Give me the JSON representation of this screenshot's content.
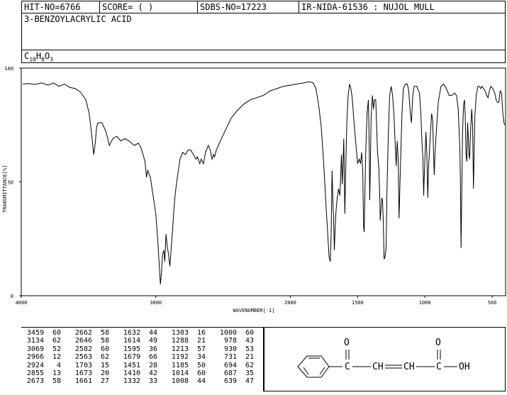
{
  "header": {
    "hit_no": "HIT-NO=6766",
    "score": "SCORE=  (   )",
    "sdbs_no": "SDBS-NO=17223",
    "ir_nida": "IR-NIDA-61536 : NUJOL MULL",
    "compound_name": "3-BENZOYLACRYLIC ACID",
    "formula_C": "C",
    "formula_C_sub": "10",
    "formula_H": "H",
    "formula_H_sub": "8",
    "formula_O": "O",
    "formula_O_sub": "3"
  },
  "chart_data": {
    "type": "line",
    "xlabel": "WAVENUMBER[-1]",
    "ylabel": "TRANSMITTANCE[%]",
    "xlim": [
      4000,
      400
    ],
    "ylim": [
      0,
      100
    ],
    "x_ticks": [
      4000,
      3000,
      2000,
      1500,
      1000,
      500
    ],
    "y_ticks": [
      0,
      50,
      100
    ],
    "series": [
      {
        "color": "#000000",
        "points": [
          [
            3988,
            93
          ],
          [
            3950,
            93.2
          ],
          [
            3900,
            92.8
          ],
          [
            3850,
            93.5
          ],
          [
            3800,
            92.5
          ],
          [
            3760,
            93.5
          ],
          [
            3720,
            92
          ],
          [
            3680,
            93
          ],
          [
            3640,
            91.5
          ],
          [
            3600,
            91
          ],
          [
            3560,
            89.5
          ],
          [
            3520,
            86
          ],
          [
            3495,
            80
          ],
          [
            3475,
            70
          ],
          [
            3462,
            62
          ],
          [
            3450,
            67
          ],
          [
            3440,
            74
          ],
          [
            3430,
            76
          ],
          [
            3400,
            76
          ],
          [
            3370,
            72
          ],
          [
            3345,
            66
          ],
          [
            3320,
            69
          ],
          [
            3290,
            70
          ],
          [
            3260,
            68
          ],
          [
            3230,
            69
          ],
          [
            3200,
            68
          ],
          [
            3180,
            67
          ],
          [
            3160,
            66
          ],
          [
            3130,
            67
          ],
          [
            3110,
            65
          ],
          [
            3095,
            62
          ],
          [
            3080,
            59
          ],
          [
            3069,
            52
          ],
          [
            3060,
            55
          ],
          [
            3040,
            52
          ],
          [
            3020,
            44
          ],
          [
            3000,
            36
          ],
          [
            2985,
            24
          ],
          [
            2975,
            14
          ],
          [
            2966,
            5
          ],
          [
            2958,
            10
          ],
          [
            2950,
            18
          ],
          [
            2940,
            20
          ],
          [
            2933,
            15
          ],
          [
            2924,
            27
          ],
          [
            2915,
            22
          ],
          [
            2905,
            18
          ],
          [
            2895,
            13
          ],
          [
            2887,
            20
          ],
          [
            2876,
            28
          ],
          [
            2865,
            38
          ],
          [
            2855,
            45
          ],
          [
            2840,
            52
          ],
          [
            2820,
            60
          ],
          [
            2800,
            63
          ],
          [
            2780,
            62
          ],
          [
            2760,
            64
          ],
          [
            2740,
            64
          ],
          [
            2720,
            62
          ],
          [
            2700,
            60
          ],
          [
            2690,
            61
          ],
          [
            2673,
            58
          ],
          [
            2662,
            60
          ],
          [
            2646,
            58
          ],
          [
            2630,
            63
          ],
          [
            2610,
            66
          ],
          [
            2595,
            64
          ],
          [
            2582,
            60
          ],
          [
            2570,
            62
          ],
          [
            2563,
            61
          ],
          [
            2550,
            64
          ],
          [
            2520,
            68
          ],
          [
            2480,
            73
          ],
          [
            2440,
            78
          ],
          [
            2400,
            81
          ],
          [
            2350,
            84
          ],
          [
            2300,
            86
          ],
          [
            2250,
            87
          ],
          [
            2200,
            88
          ],
          [
            2150,
            90
          ],
          [
            2100,
            91
          ],
          [
            2050,
            92
          ],
          [
            2000,
            92.5
          ],
          [
            1950,
            93
          ],
          [
            1900,
            93.5
          ],
          [
            1860,
            94
          ],
          [
            1830,
            93.5
          ],
          [
            1810,
            91
          ],
          [
            1790,
            84
          ],
          [
            1770,
            74
          ],
          [
            1750,
            56
          ],
          [
            1735,
            40
          ],
          [
            1720,
            25
          ],
          [
            1712,
            17
          ],
          [
            1703,
            15
          ],
          [
            1697,
            26
          ],
          [
            1690,
            55
          ],
          [
            1682,
            38
          ],
          [
            1679,
            36
          ],
          [
            1676,
            28
          ],
          [
            1673,
            20
          ],
          [
            1668,
            28
          ],
          [
            1661,
            37
          ],
          [
            1652,
            43
          ],
          [
            1642,
            47
          ],
          [
            1632,
            44
          ],
          [
            1625,
            54
          ],
          [
            1620,
            62
          ],
          [
            1614,
            49
          ],
          [
            1608,
            58
          ],
          [
            1603,
            69
          ],
          [
            1595,
            36
          ],
          [
            1588,
            56
          ],
          [
            1580,
            76
          ],
          [
            1570,
            88
          ],
          [
            1560,
            93
          ],
          [
            1550,
            91
          ],
          [
            1540,
            87
          ],
          [
            1530,
            79
          ],
          [
            1515,
            68
          ],
          [
            1500,
            58
          ],
          [
            1488,
            60
          ],
          [
            1478,
            58
          ],
          [
            1470,
            63
          ],
          [
            1462,
            55
          ],
          [
            1458,
            40
          ],
          [
            1455,
            30
          ],
          [
            1451,
            28
          ],
          [
            1446,
            45
          ],
          [
            1440,
            62
          ],
          [
            1430,
            80
          ],
          [
            1420,
            86
          ],
          [
            1413,
            64
          ],
          [
            1410,
            42
          ],
          [
            1405,
            56
          ],
          [
            1400,
            78
          ],
          [
            1390,
            88
          ],
          [
            1382,
            82
          ],
          [
            1375,
            86
          ],
          [
            1365,
            86
          ],
          [
            1352,
            63
          ],
          [
            1342,
            56
          ],
          [
            1335,
            43
          ],
          [
            1332,
            33
          ],
          [
            1328,
            36
          ],
          [
            1320,
            43
          ],
          [
            1315,
            42
          ],
          [
            1310,
            34
          ],
          [
            1303,
            16
          ],
          [
            1296,
            17
          ],
          [
            1288,
            21
          ],
          [
            1282,
            46
          ],
          [
            1272,
            70
          ],
          [
            1262,
            88
          ],
          [
            1250,
            92
          ],
          [
            1240,
            88
          ],
          [
            1230,
            80
          ],
          [
            1218,
            63
          ],
          [
            1213,
            57
          ],
          [
            1206,
            68
          ],
          [
            1198,
            60
          ],
          [
            1192,
            34
          ],
          [
            1188,
            42
          ],
          [
            1185,
            50
          ],
          [
            1178,
            64
          ],
          [
            1170,
            80
          ],
          [
            1160,
            91
          ],
          [
            1145,
            93
          ],
          [
            1130,
            93
          ],
          [
            1120,
            90
          ],
          [
            1108,
            80
          ],
          [
            1100,
            76
          ],
          [
            1090,
            88
          ],
          [
            1080,
            92
          ],
          [
            1060,
            92
          ],
          [
            1040,
            89
          ],
          [
            1030,
            80
          ],
          [
            1022,
            68
          ],
          [
            1014,
            60
          ],
          [
            1009,
            44
          ],
          [
            1006,
            50
          ],
          [
            1000,
            60
          ],
          [
            992,
            72
          ],
          [
            985,
            62
          ],
          [
            978,
            43
          ],
          [
            973,
            56
          ],
          [
            960,
            70
          ],
          [
            950,
            80
          ],
          [
            942,
            77
          ],
          [
            935,
            62
          ],
          [
            930,
            53
          ],
          [
            925,
            62
          ],
          [
            915,
            72
          ],
          [
            900,
            85
          ],
          [
            880,
            92
          ],
          [
            860,
            93
          ],
          [
            840,
            91
          ],
          [
            820,
            88
          ],
          [
            800,
            88
          ],
          [
            780,
            89
          ],
          [
            765,
            88
          ],
          [
            752,
            82
          ],
          [
            740,
            65
          ],
          [
            736,
            50
          ],
          [
            731,
            21
          ],
          [
            726,
            44
          ],
          [
            720,
            72
          ],
          [
            712,
            84
          ],
          [
            705,
            86
          ],
          [
            700,
            79
          ],
          [
            694,
            62
          ],
          [
            688,
            59
          ],
          [
            682,
            76
          ],
          [
            676,
            68
          ],
          [
            672,
            62
          ],
          [
            667,
            60
          ],
          [
            662,
            70
          ],
          [
            652,
            82
          ],
          [
            645,
            75
          ],
          [
            639,
            47
          ],
          [
            634,
            62
          ],
          [
            628,
            79
          ],
          [
            618,
            88
          ],
          [
            606,
            92
          ],
          [
            595,
            92
          ],
          [
            585,
            91
          ],
          [
            575,
            92
          ],
          [
            565,
            91
          ],
          [
            552,
            90
          ],
          [
            540,
            88
          ],
          [
            530,
            87
          ],
          [
            520,
            90
          ],
          [
            510,
            92
          ],
          [
            495,
            91
          ],
          [
            480,
            89
          ],
          [
            470,
            86
          ],
          [
            460,
            85
          ],
          [
            450,
            85
          ],
          [
            440,
            90
          ],
          [
            430,
            89
          ],
          [
            420,
            80
          ],
          [
            412,
            76
          ],
          [
            405,
            75
          ]
        ]
      }
    ]
  },
  "peak_table": {
    "columns": [
      [
        [
          "3459",
          "60"
        ],
        [
          "3134",
          "62"
        ],
        [
          "3069",
          "52"
        ],
        [
          "2966",
          "12"
        ],
        [
          "2924",
          "4"
        ],
        [
          "2855",
          "13"
        ],
        [
          "2673",
          "58"
        ]
      ],
      [
        [
          "2662",
          "58"
        ],
        [
          "2646",
          "58"
        ],
        [
          "2582",
          "60"
        ],
        [
          "2563",
          "62"
        ],
        [
          "1703",
          "15"
        ],
        [
          "1673",
          "20"
        ],
        [
          "1661",
          "27"
        ]
      ],
      [
        [
          "1632",
          "44"
        ],
        [
          "1614",
          "49"
        ],
        [
          "1595",
          "36"
        ],
        [
          "1679",
          "66"
        ],
        [
          "1451",
          "28"
        ],
        [
          "1410",
          "42"
        ],
        [
          "1332",
          "33"
        ]
      ],
      [
        [
          "1303",
          "16"
        ],
        [
          "1288",
          "21"
        ],
        [
          "1213",
          "57"
        ],
        [
          "1192",
          "34"
        ],
        [
          "1185",
          "50"
        ],
        [
          "1014",
          "60"
        ],
        [
          "1008",
          "44"
        ]
      ],
      [
        [
          "1000",
          "60"
        ],
        [
          "978",
          "43"
        ],
        [
          "930",
          "53"
        ],
        [
          "731",
          "21"
        ],
        [
          "694",
          "62"
        ],
        [
          "687",
          "35"
        ],
        [
          "639",
          "47"
        ]
      ]
    ]
  },
  "structure": {
    "oxygen_left": "O",
    "oxygen_right": "O",
    "chain": "C—CH=CH—C—OH",
    "c1": "C",
    "ch1": "CH",
    "ch2": "CH",
    "c2": "C",
    "oh": "OH"
  }
}
